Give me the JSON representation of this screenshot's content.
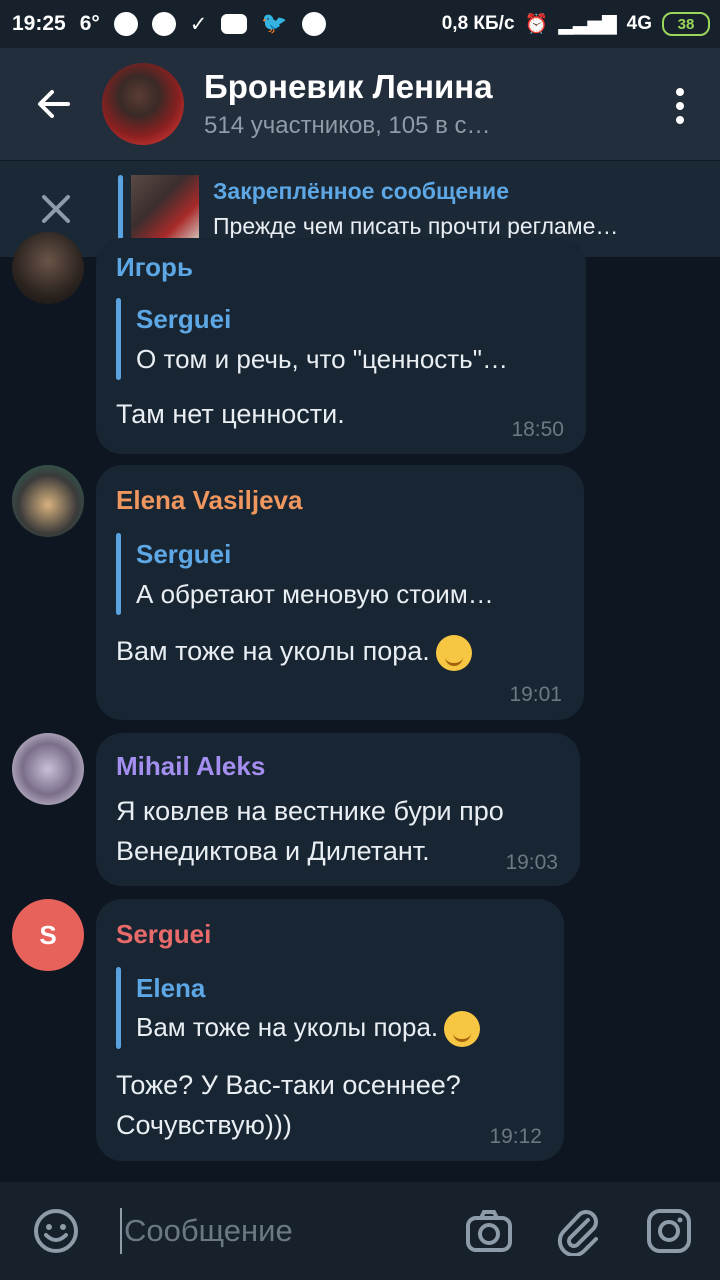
{
  "status": {
    "time": "19:25",
    "temp": "6°",
    "speed": "0,8 КБ/с",
    "network": "4G",
    "battery": "38"
  },
  "header": {
    "title": "Броневик Ленина",
    "subtitle": "514 участников, 105 в с…"
  },
  "pinned": {
    "title": "Закреплённое сообщение",
    "text": "Прежде чем писать прочти регламе…"
  },
  "messages": [
    {
      "sender": "Игорь",
      "sender_color": "#5ea7e5",
      "reply_name": "Serguei",
      "reply_text": "О том и речь, что \"ценность\"…",
      "text": "Там нет ценности.",
      "time": "18:50"
    },
    {
      "sender": "Elena Vasiljeva",
      "sender_color": "#f0975f",
      "reply_name": "Serguei",
      "reply_text": "А обретают меновую стоим…",
      "text": "Вам тоже на уколы пора.",
      "time": "19:01"
    },
    {
      "sender": "Mihail Aleks",
      "sender_color": "#a48ef0",
      "text_line1": "Я ковлев на вестнике бури про",
      "text_line2": "Венедиктова и Дилетант.",
      "time": "19:03"
    },
    {
      "sender": "Serguei",
      "sender_color": "#e96a6a",
      "avatar_letter": "S",
      "avatar_color": "#e8625c",
      "reply_name": "Elena",
      "reply_text": "Вам тоже на уколы пора.",
      "text_line1": "Тоже? У Вас-таки осеннее?",
      "text_line2": "Сочувствую)))",
      "time": "19:12"
    }
  ],
  "input": {
    "placeholder": "Сообщение"
  }
}
